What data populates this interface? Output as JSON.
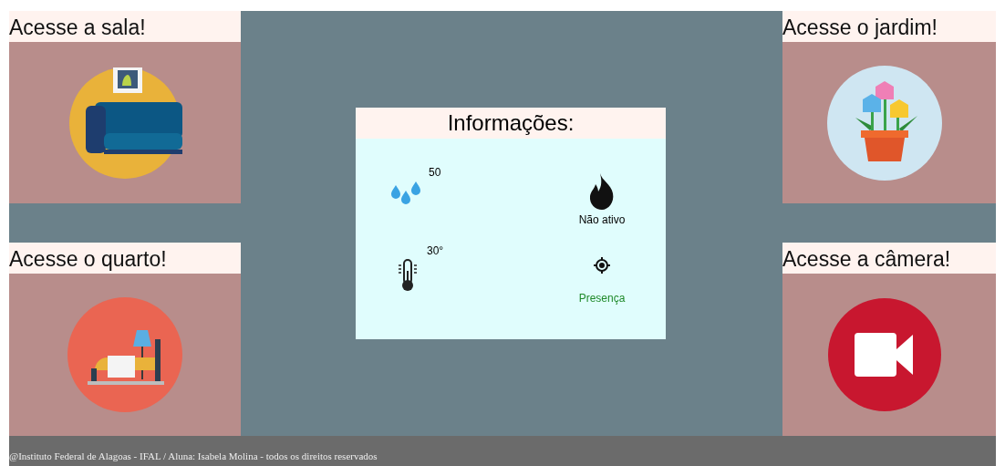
{
  "rooms": [
    {
      "kind": "living",
      "title": "Acesse a sala!"
    },
    {
      "kind": "bedroom",
      "title": "Acesse o quarto!"
    },
    {
      "kind": "garden",
      "title": "Acesse o jardim!"
    },
    {
      "kind": "camera",
      "title": "Acesse a câmera!"
    }
  ],
  "info": {
    "title": "Informações:",
    "sensors": [
      {
        "kind": "humidity",
        "value": "50"
      },
      {
        "kind": "fire",
        "value": "Não ativo"
      },
      {
        "kind": "temperature",
        "value": "30°"
      },
      {
        "kind": "presence",
        "value": "Presença"
      }
    ]
  },
  "footer": "@Instituto Federal de Alagoas - IFAL / Aluna: Isabela Molina - todos os direitos reservados"
}
